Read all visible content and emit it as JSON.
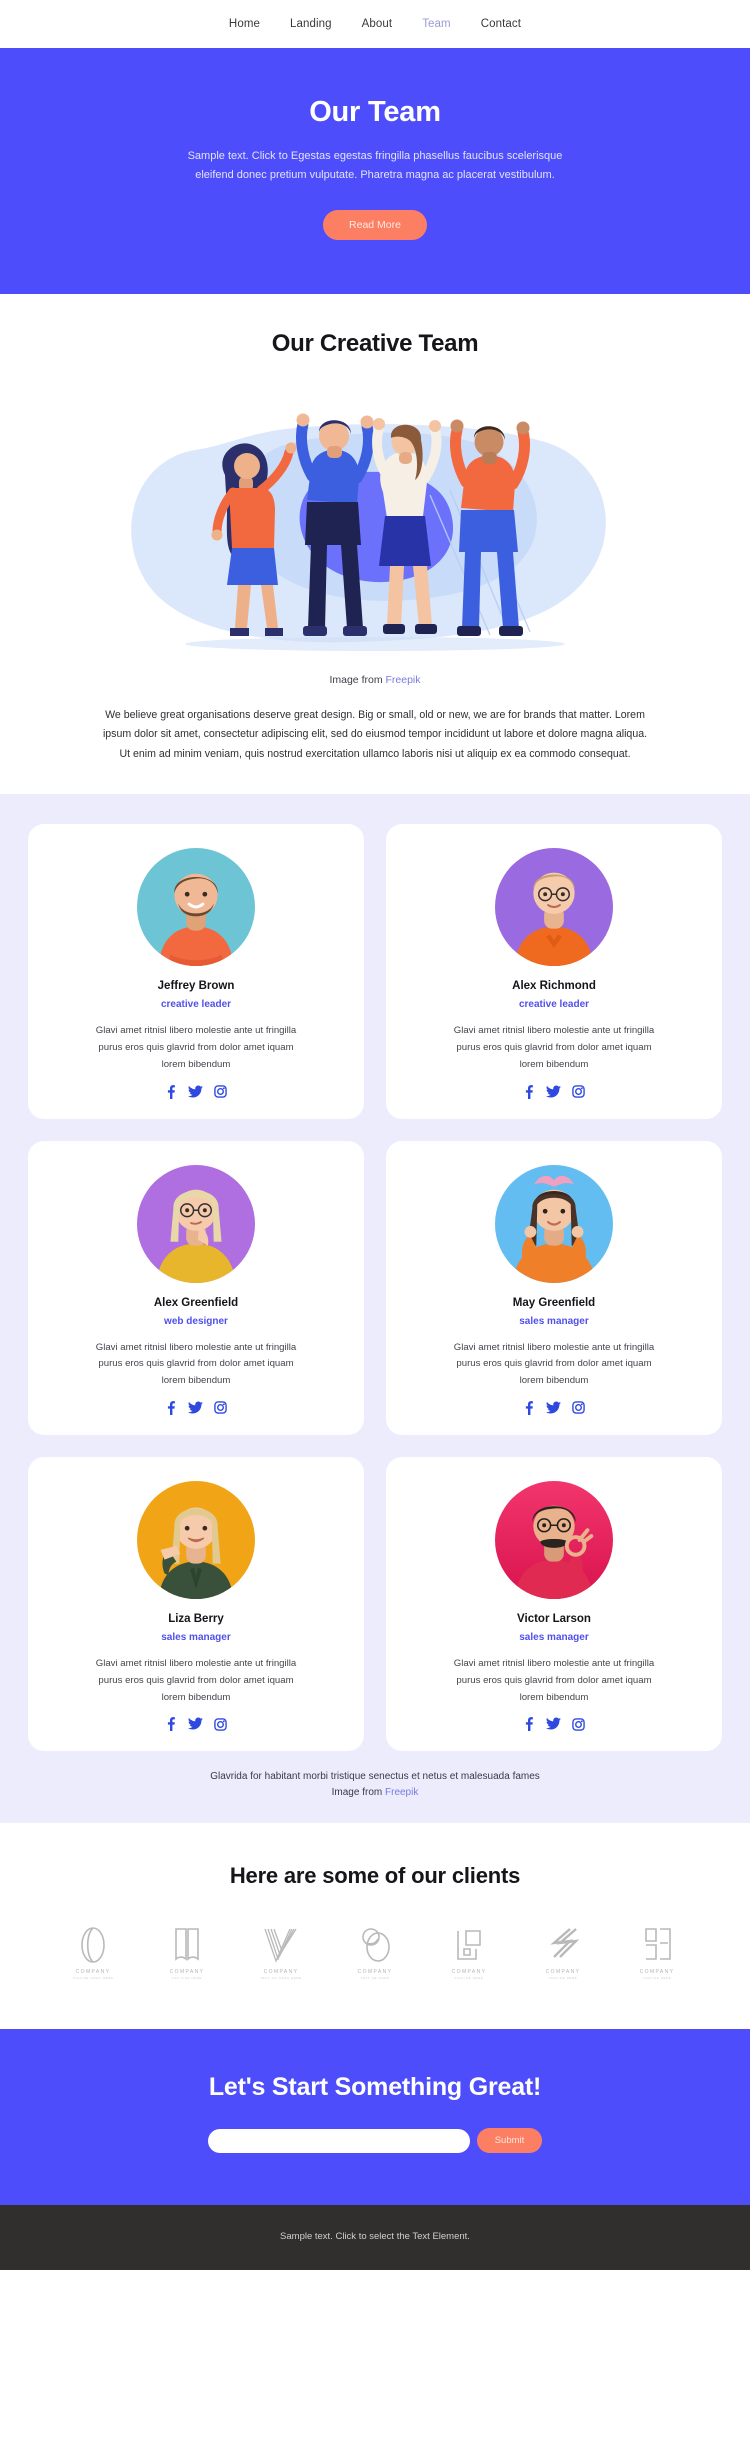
{
  "nav": {
    "items": [
      {
        "label": "Home",
        "active": false
      },
      {
        "label": "Landing",
        "active": false
      },
      {
        "label": "About",
        "active": false
      },
      {
        "label": "Team",
        "active": true
      },
      {
        "label": "Contact",
        "active": false
      }
    ]
  },
  "hero": {
    "title": "Our Team",
    "subtitle": "Sample text. Click to Egestas egestas fringilla phasellus faucibus scelerisque eleifend donec pretium vulputate. Pharetra magna ac placerat vestibulum.",
    "button_label": "Read More",
    "bg_color": "#4d4dfb",
    "button_color": "#fc7f63"
  },
  "creative": {
    "title": "Our Creative Team",
    "image_credit_prefix": "Image from ",
    "image_credit_link": "Freepik",
    "paragraph": "We believe great organisations deserve great design. Big or small, old or new, we are for brands that matter. Lorem ipsum dolor sit amet, consectetur adipiscing elit, sed do eiusmod tempor incididunt ut labore et dolore magna aliqua. Ut enim ad minim veniam, quis nostrud exercitation ullamco laboris nisi ut aliquip ex ea commodo consequat."
  },
  "team": {
    "bio_default": "Glavi amet ritnisl libero molestie ante ut fringilla purus eros quis glavrid from dolor amet iquam lorem bibendum",
    "role_color": "#5050ea",
    "members": [
      {
        "name": "Jeffrey Brown",
        "role": "creative leader",
        "bio": "Glavi amet ritnisl libero molestie ante ut fringilla purus eros quis glavrid from dolor amet iquam lorem bibendum",
        "avatar_bg": "#6cc4d4",
        "shirt": "#f2683f",
        "hair": "#6b4a2f",
        "skin": "#f0b894"
      },
      {
        "name": "Alex Richmond",
        "role": "creative leader",
        "bio": "Glavi amet ritnisl libero molestie ante ut fringilla purus eros quis glavrid from dolor amet iquam lorem bibendum",
        "avatar_bg": "#9a6ae0",
        "shirt": "#ef6a1f",
        "hair": "#caa06a",
        "skin": "#f5cbab"
      },
      {
        "name": "Alex Greenfield",
        "role": "web designer",
        "bio": "Glavi amet ritnisl libero molestie ante ut fringilla purus eros quis glavrid from dolor amet iquam lorem bibendum",
        "avatar_bg": "#b06fe0",
        "shirt": "#e8b62c",
        "hair": "#e8d7a8",
        "skin": "#f5cbab"
      },
      {
        "name": "May Greenfield",
        "role": "sales manager",
        "bio": "Glavi amet ritnisl libero molestie ante ut fringilla purus eros quis glavrid from dolor amet iquam lorem bibendum",
        "avatar_bg": "#63bdf0",
        "shirt": "#f07f2a",
        "hair": "#4a3326",
        "skin": "#f3c7a6"
      },
      {
        "name": "Liza Berry",
        "role": "sales manager",
        "bio": "Glavi amet ritnisl libero molestie ante ut fringilla purus eros quis glavrid from dolor amet iquam lorem bibendum",
        "avatar_bg": "#f2a417",
        "shirt": "#39503a",
        "hair": "#e2c98f",
        "skin": "#f5cbab"
      },
      {
        "name": "Victor Larson",
        "role": "sales manager",
        "bio": "Glavi amet ritnisl libero molestie ante ut fringilla purus eros quis glavrid from dolor amet iquam lorem bibendum",
        "avatar_bg": "#e8265e",
        "shirt": "#e02a52",
        "hair": "#2b2320",
        "skin": "#e9b18c"
      }
    ],
    "socials": [
      {
        "name": "facebook-icon",
        "label": "f"
      },
      {
        "name": "twitter-icon",
        "label": "twitter"
      },
      {
        "name": "instagram-icon",
        "label": "instagram"
      }
    ],
    "footnote_line1": "Glavrida for habitant morbi tristique senectus et netus et malesuada fames",
    "footnote_line2_prefix": "Image from ",
    "footnote_line2_link": "Freepik",
    "bg_color": "#ececfd"
  },
  "clients": {
    "title": "Here are some of our clients",
    "logos": [
      {
        "name": "COMPANY",
        "tagline": "TAGLINE GOES HERE"
      },
      {
        "name": "COMPANY",
        "tagline": "TAG LINE HERE"
      },
      {
        "name": "COMPANY",
        "tagline": "TEXT GO GOES HERE"
      },
      {
        "name": "COMPANY",
        "tagline": "TEXT HE GOES"
      },
      {
        "name": "COMPANY",
        "tagline": "TAGLINE HERE"
      },
      {
        "name": "COMPANY",
        "tagline": "TAGLINE HERE"
      },
      {
        "name": "COMPANY",
        "tagline": "TAGLINE HERE"
      }
    ]
  },
  "cta": {
    "title": "Let's Start Something Great!",
    "input_placeholder": "",
    "input_value": "",
    "submit_label": "Submit",
    "bg_color": "#4d4dfb"
  },
  "footer": {
    "text": "Sample text. Click to select the Text Element.",
    "bg_color": "#302f2d"
  }
}
